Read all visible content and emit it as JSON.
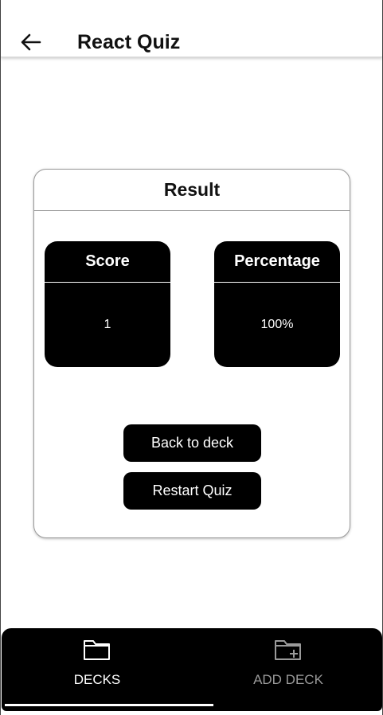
{
  "header": {
    "title": "React Quiz",
    "back_icon": "arrow-left-icon"
  },
  "result_card": {
    "title": "Result",
    "score": {
      "label": "Score",
      "value": "1"
    },
    "percentage": {
      "label": "Percentage",
      "value": "100%"
    },
    "back_button_label": "Back to deck",
    "restart_button_label": "Restart Quiz"
  },
  "bottom_nav": {
    "items": [
      {
        "label": "DECKS",
        "icon": "folder-icon",
        "active": true
      },
      {
        "label": "ADD DECK",
        "icon": "folder-plus-icon",
        "active": false
      }
    ],
    "active_color": "#ffffff",
    "inactive_color": "#9a9a9a"
  }
}
